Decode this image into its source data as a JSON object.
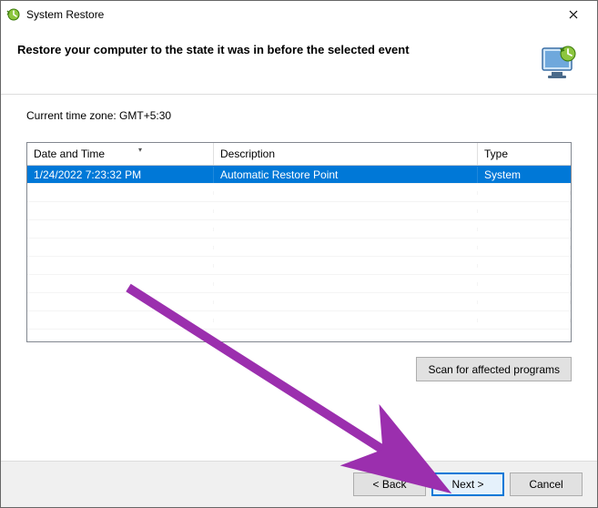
{
  "titlebar": {
    "title": "System Restore"
  },
  "header": {
    "heading": "Restore your computer to the state it was in before the selected event"
  },
  "timezone_label": "Current time zone: GMT+5:30",
  "table": {
    "columns": {
      "date": "Date and Time",
      "desc": "Description",
      "type": "Type"
    },
    "rows": [
      {
        "date": "1/24/2022 7:23:32 PM",
        "desc": "Automatic Restore Point",
        "type": "System"
      }
    ]
  },
  "buttons": {
    "scan": "Scan for affected programs",
    "back": "< Back",
    "next": "Next >",
    "cancel": "Cancel"
  }
}
